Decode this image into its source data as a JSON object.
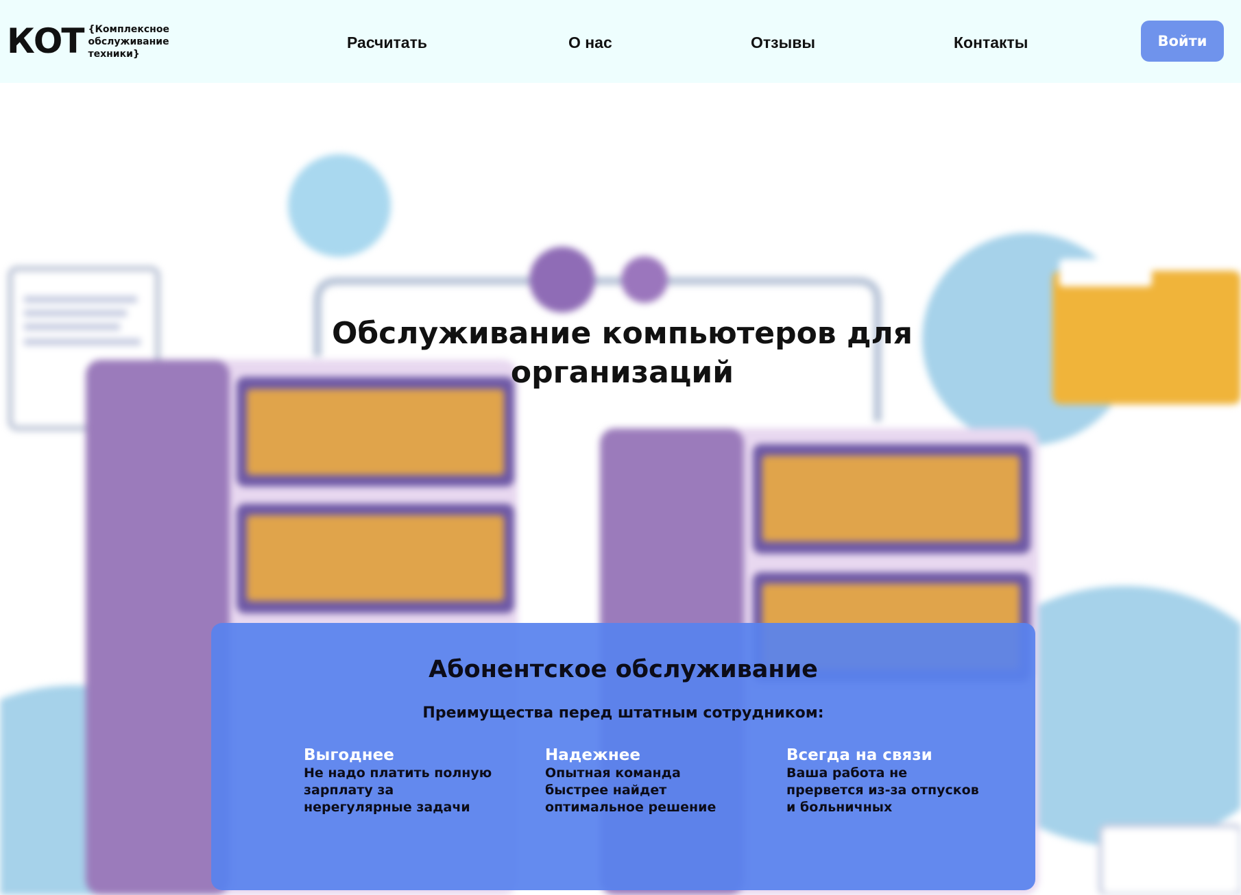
{
  "header": {
    "logo": {
      "mark": "КОТ",
      "tag": "{Комплексное обслуживание техники}"
    },
    "nav": [
      {
        "label": "Расчитать"
      },
      {
        "label": "О нас"
      },
      {
        "label": "Отзывы"
      },
      {
        "label": "Контакты"
      }
    ],
    "login_label": "Войти"
  },
  "hero": {
    "title": "Обслуживание компьютеров для организаций"
  },
  "card": {
    "title": "Абонентское обслуживание",
    "subtitle": "Преимущества перед штатным сотрудником:",
    "features": [
      {
        "heading": "Выгоднее",
        "text": "Не надо платить полную зарплату за нерегулярные задачи"
      },
      {
        "heading": "Надежнее",
        "text": "Опытная команда быстрее найдет оптимальное решение"
      },
      {
        "heading": "Всегда на связи",
        "text": "Ваша работа не прервется из-за отпусков и больничных"
      }
    ]
  },
  "colors": {
    "header_bg": "#eefefe",
    "accent": "#6f93ec",
    "card_bg": "#5882ee",
    "server_purple": "#9b7bbb",
    "server_orange": "#e0a44b",
    "folder": "#f0b43a"
  }
}
